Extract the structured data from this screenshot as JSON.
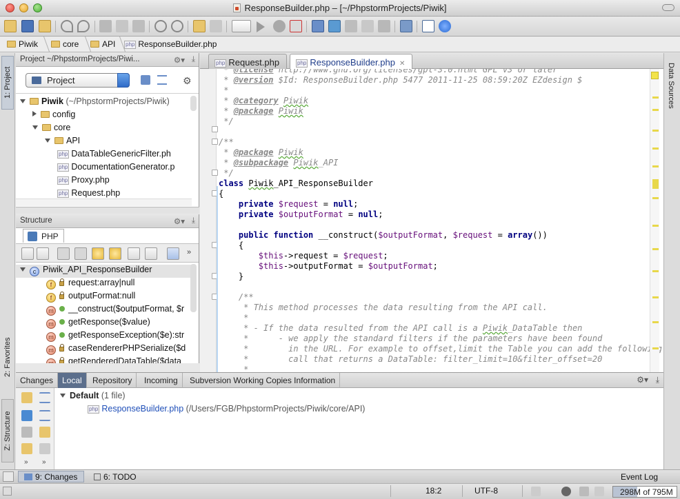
{
  "window": {
    "title": "ResponseBuilder.php – [~/PhpstormProjects/Piwik]"
  },
  "breadcrumb": [
    {
      "label": "Piwik",
      "type": "folder"
    },
    {
      "label": "core",
      "type": "folder"
    },
    {
      "label": "API",
      "type": "folder"
    },
    {
      "label": "ResponseBuilder.php",
      "type": "php"
    }
  ],
  "left_tools": {
    "project": "1: Project",
    "favorites": "2: Favorites",
    "structure": "Z: Structure"
  },
  "right_tools": {
    "data_sources": "Data Sources"
  },
  "project_panel": {
    "header": "Project ~/PhpstormProjects/Piwi...",
    "view_combo": "Project",
    "tree": [
      {
        "label": "Piwik",
        "suffix": " (~/PhpstormProjects/Piwik)",
        "level": 0,
        "kind": "folder",
        "expanded": true
      },
      {
        "label": "config",
        "level": 1,
        "kind": "folder",
        "expanded": false
      },
      {
        "label": "core",
        "level": 1,
        "kind": "folder",
        "expanded": true
      },
      {
        "label": "API",
        "level": 2,
        "kind": "folder",
        "expanded": true
      },
      {
        "label": "DataTableGenericFilter.ph",
        "level": 3,
        "kind": "php"
      },
      {
        "label": "DocumentationGenerator.p",
        "level": 3,
        "kind": "php"
      },
      {
        "label": "Proxy.php",
        "level": 3,
        "kind": "php"
      },
      {
        "label": "Request.php",
        "level": 3,
        "kind": "php"
      }
    ]
  },
  "structure_panel": {
    "header": "Structure",
    "tab": "PHP",
    "items": [
      {
        "label": "Piwik_API_ResponseBuilder",
        "badge": "c",
        "level": 0
      },
      {
        "label": "request:array|null",
        "badge": "f",
        "level": 1,
        "lock": true
      },
      {
        "label": "outputFormat:null",
        "badge": "f",
        "level": 1,
        "lock": true
      },
      {
        "label": "__construct($outputFormat, $r",
        "badge": "m",
        "level": 1,
        "pin": true
      },
      {
        "label": "getResponse($value)",
        "badge": "m",
        "level": 1,
        "pin": true
      },
      {
        "label": "getResponseException($e):str",
        "badge": "m",
        "level": 1,
        "pin": true
      },
      {
        "label": "caseRendererPHPSerialize($d",
        "badge": "m",
        "level": 1,
        "lock": true
      },
      {
        "label": "getRenderedDataTable($data",
        "badge": "m",
        "level": 1,
        "lock": true
      }
    ]
  },
  "editor": {
    "tabs": [
      {
        "label": "Request.php",
        "active": false
      },
      {
        "label": "ResponseBuilder.php",
        "active": true
      }
    ]
  },
  "bottom_panel": {
    "tabs": [
      "Changes",
      "Local",
      "Repository",
      "Incoming",
      "Subversion Working Copies Information"
    ],
    "selected_tab": "Local",
    "changelist": "Default",
    "changelist_count": " (1 file)",
    "file_name": "ResponseBuilder.php",
    "file_path": " (/Users/FGB/PhpstormProjects/Piwik/core/API)"
  },
  "status_tools": {
    "changes": "9: Changes",
    "todo": "6: TODO",
    "event_log": "Event Log"
  },
  "status_bar": {
    "position": "18:2",
    "encoding": "UTF-8",
    "memory": "298M of 795M",
    "memory_used": 0.375
  }
}
